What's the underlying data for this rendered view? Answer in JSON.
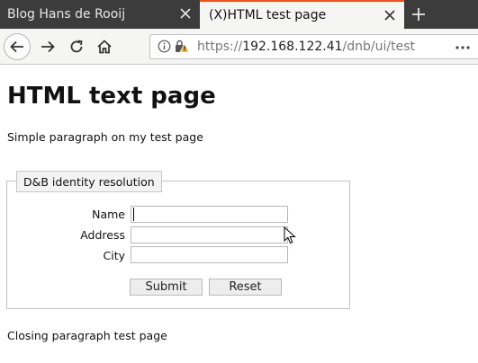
{
  "browser": {
    "tabs": [
      {
        "title": "Blog Hans de Rooij",
        "active": false
      },
      {
        "title": "(X)HTML test page",
        "active": true
      }
    ],
    "url": {
      "scheme": "https://",
      "host": "192.168.122.41",
      "path": "/dnb/ui/test"
    },
    "icons": {
      "back": "back-arrow-icon",
      "forward": "forward-arrow-icon",
      "reload": "reload-icon",
      "home": "home-icon",
      "info": "info-icon",
      "lock": "lock-warning-icon",
      "menu": "page-actions-icon",
      "close": "close-icon",
      "new_tab": "plus-icon"
    },
    "accent_color": "#e95420",
    "tabstrip_color": "#3c3c3c"
  },
  "page": {
    "heading": "HTML text page",
    "intro": "Simple paragraph on my test page",
    "form": {
      "legend": "D&B identity resolution",
      "fields": [
        {
          "label": "Name",
          "value": ""
        },
        {
          "label": "Address",
          "value": ""
        },
        {
          "label": "City",
          "value": ""
        }
      ],
      "submit_label": "Submit",
      "reset_label": "Reset"
    },
    "closing": "Closing paragraph test page"
  }
}
